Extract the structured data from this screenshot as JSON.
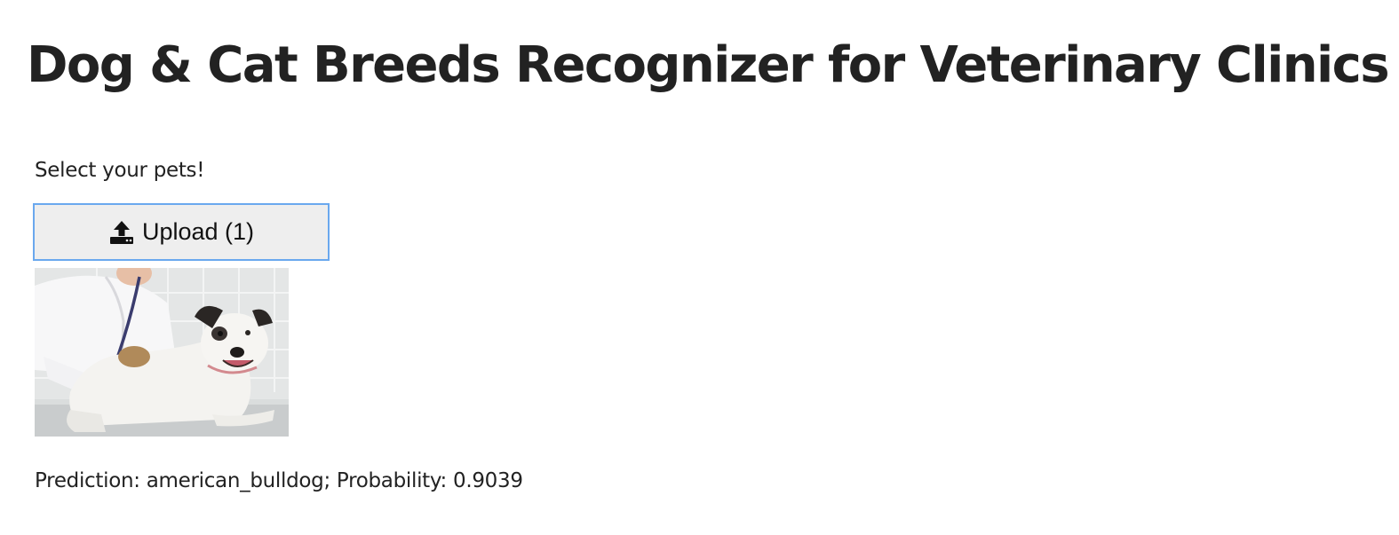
{
  "header": {
    "title": "Dog & Cat Breeds Recognizer for Veterinary Clinics"
  },
  "upload": {
    "prompt": "Select your pets!",
    "button_label": "Upload (1)",
    "button_icon": "upload-icon"
  },
  "preview": {
    "image_content": "pet-photo"
  },
  "result": {
    "text": "Prediction: american_bulldog; Probability: 0.9039"
  },
  "colors": {
    "text": "#222222",
    "button_background": "#eeeeee",
    "button_border": "#6aa8ee"
  }
}
